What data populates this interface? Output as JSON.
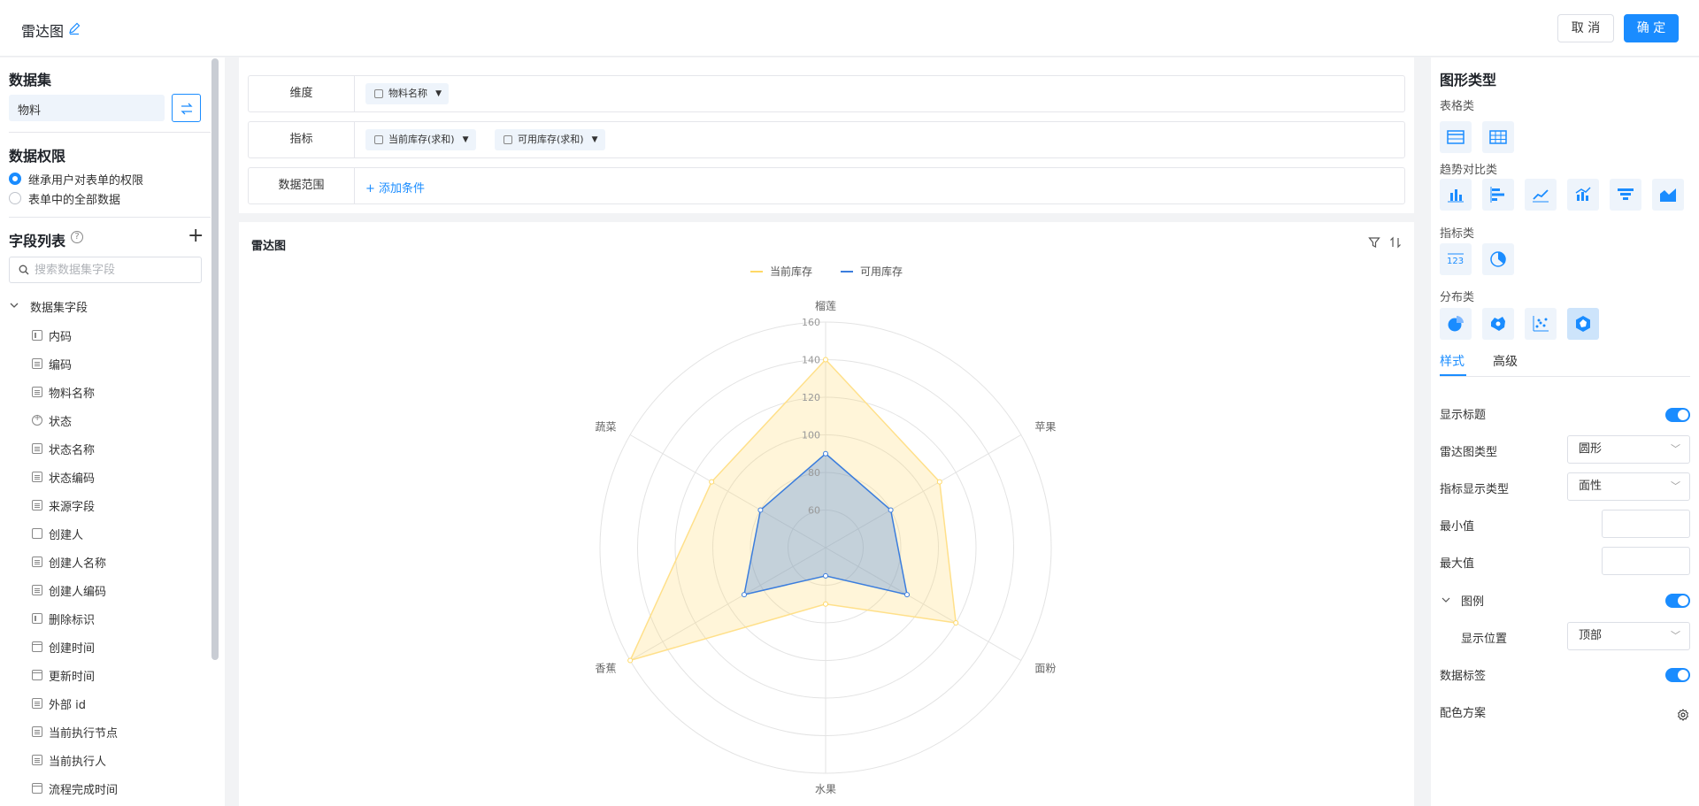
{
  "header": {
    "title": "雷达图",
    "cancel": "取 消",
    "ok": "确 定"
  },
  "left": {
    "dataset_title": "数据集",
    "dataset_value": "物料",
    "perm_title": "数据权限",
    "perm_options": [
      "继承用户对表单的权限",
      "表单中的全部数据"
    ],
    "field_title": "字段列表",
    "search_placeholder": "搜索数据集字段",
    "group_label": "数据集字段",
    "fields": [
      "内码",
      "编码",
      "物料名称",
      "状态",
      "状态名称",
      "状态编码",
      "来源字段",
      "创建人",
      "创建人名称",
      "创建人编码",
      "删除标识",
      "创建时间",
      "更新时间",
      "外部 id",
      "当前执行节点",
      "当前执行人",
      "流程完成时间"
    ]
  },
  "config": {
    "dimension_label": "维度",
    "dimension_chip": "物料名称",
    "metric_label": "指标",
    "metric_chips": [
      "当前库存(求和)",
      "可用库存(求和)"
    ],
    "range_label": "数据范围",
    "add_condition": "+ 添加条件"
  },
  "chart_panel": {
    "title": "雷达图"
  },
  "chart_data": {
    "type": "radar",
    "indicators": [
      "榴莲",
      "苹果",
      "面粉",
      "水果",
      "香蕉",
      "蔬菜"
    ],
    "ticks": [
      60,
      80,
      100,
      120,
      140,
      160
    ],
    "range": [
      40,
      160
    ],
    "series": [
      {
        "name": "当前库存",
        "values": [
          140,
          110,
          120,
          70,
          160,
          110
        ],
        "color": "#ffd966"
      },
      {
        "name": "可用库存",
        "values": [
          90,
          80,
          90,
          55,
          90,
          80
        ],
        "color": "#3b7ddd"
      }
    ],
    "legend": "top-center",
    "shape": "circle"
  },
  "right": {
    "title": "图形类型",
    "categories": [
      "表格类",
      "趋势对比类",
      "指标类",
      "分布类"
    ],
    "tabs": [
      "样式",
      "高级"
    ],
    "props": {
      "show_title": "显示标题",
      "radar_type": "雷达图类型",
      "radar_type_value": "圆形",
      "metric_display": "指标显示类型",
      "metric_display_value": "面性",
      "min": "最小值",
      "max": "最大值",
      "legend": "图例",
      "legend_pos": "显示位置",
      "legend_pos_value": "顶部",
      "data_label": "数据标签",
      "color_scheme": "配色方案"
    }
  }
}
